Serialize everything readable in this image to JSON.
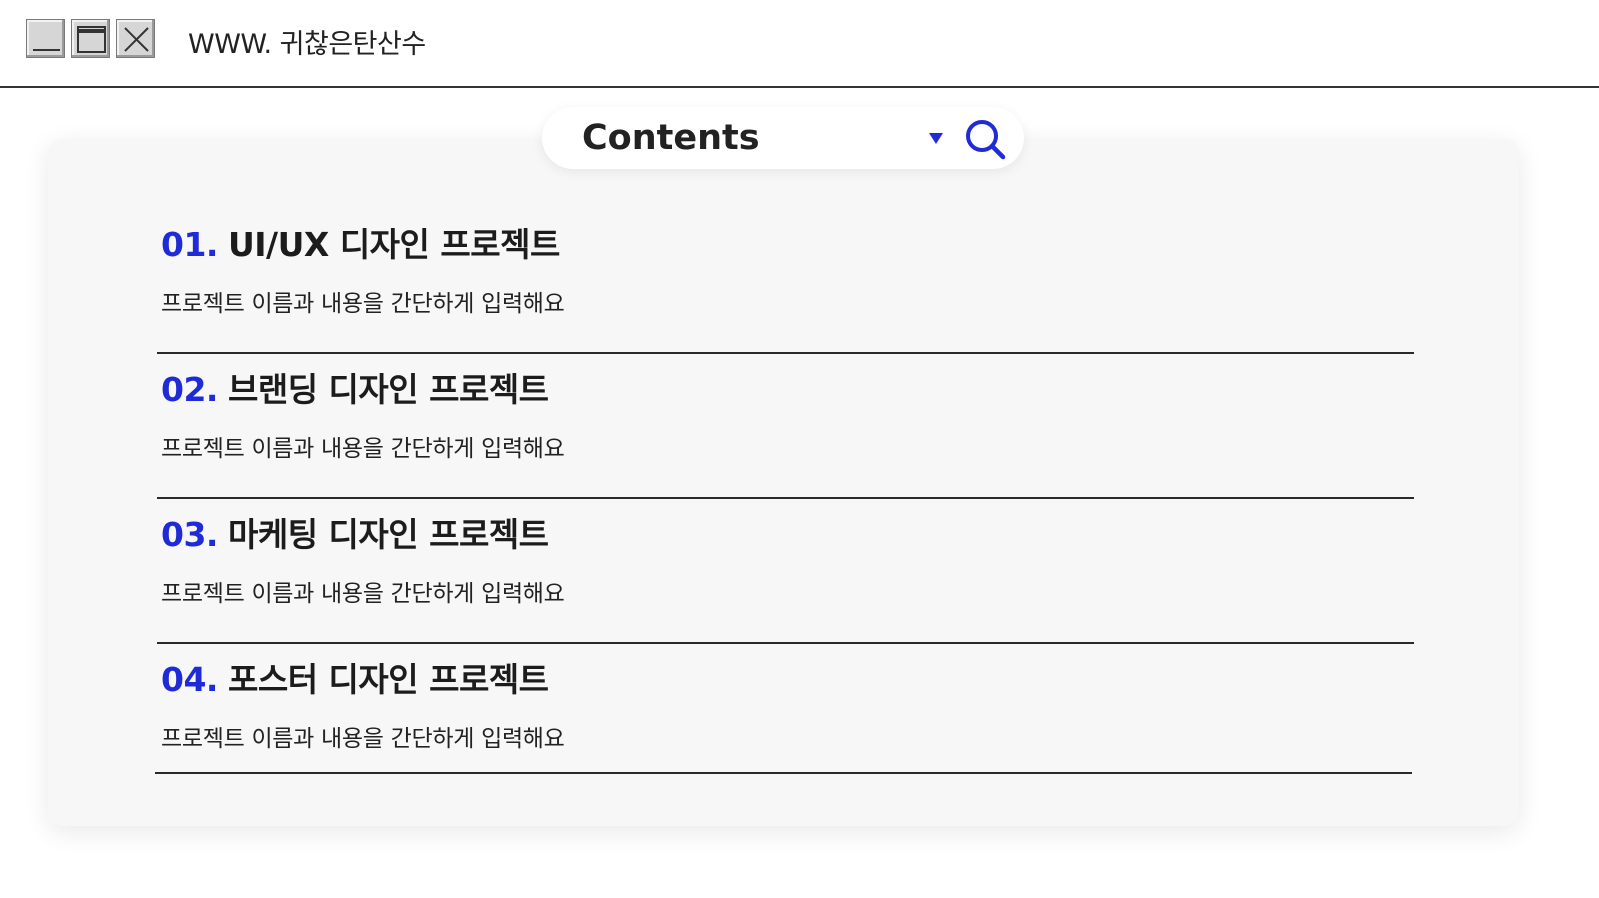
{
  "window": {
    "url_text": "WWW. 귀찮은탄산수",
    "controls": [
      "minimize",
      "maximize",
      "close"
    ]
  },
  "search": {
    "label": "Contents",
    "dropdown_icon": "triangle-down-icon",
    "search_icon": "search-icon",
    "accent": "#1f2bd6"
  },
  "projects": [
    {
      "number": "01.",
      "title": "UI/UX 디자인 프로젝트",
      "description": "프로젝트 이름과 내용을  간단하게 입력해요"
    },
    {
      "number": "02.",
      "title": "브랜딩 디자인 프로젝트",
      "description": "프로젝트 이름과 내용을  간단하게 입력해요"
    },
    {
      "number": "03.",
      "title": "마케팅 디자인 프로젝트",
      "description": "프로젝트 이름과 내용을  간단하게 입력해요"
    },
    {
      "number": "04.",
      "title": "포스터 디자인 프로젝트",
      "description": "프로젝트 이름과 내용을  간단하게 입력해요"
    }
  ],
  "colors": {
    "accent_blue": "#1f2bd6",
    "panel_bg": "#f7f7f7",
    "divider": "#2a2a2a"
  }
}
